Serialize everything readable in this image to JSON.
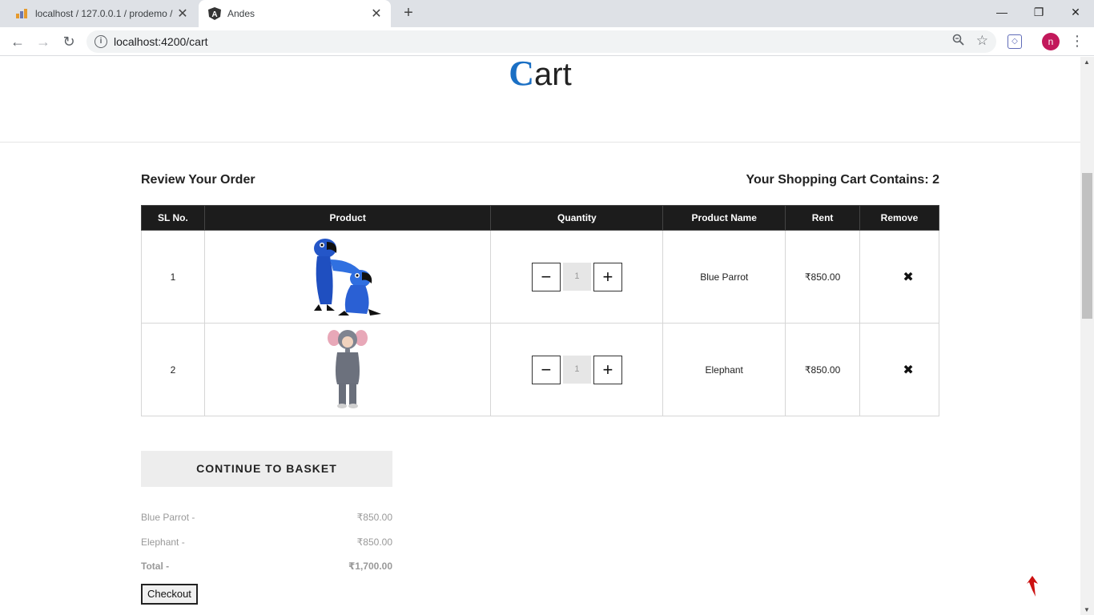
{
  "browser": {
    "tabs": [
      {
        "title": "localhost / 127.0.0.1 / prodemo /",
        "favicon": "phpmyadmin-icon",
        "active": false
      },
      {
        "title": "Andes",
        "favicon": "angular-icon",
        "active": true
      }
    ],
    "url": "localhost:4200/cart",
    "avatar_letter": "n"
  },
  "page": {
    "title_initial": "C",
    "title_rest": "art",
    "review_heading": "Review Your Order",
    "cart_count_label": "Your Shopping Cart Contains: 2"
  },
  "table": {
    "headers": [
      "SL No.",
      "Product",
      "Quantity",
      "Product Name",
      "Rent",
      "Remove"
    ],
    "rows": [
      {
        "sl": "1",
        "image": "blue-parrot-costume",
        "qty": "1",
        "name": "Blue Parrot",
        "rent": "₹850.00"
      },
      {
        "sl": "2",
        "image": "elephant-costume",
        "qty": "1",
        "name": "Elephant",
        "rent": "₹850.00"
      }
    ]
  },
  "continue_label": "CONTINUE TO BASKET",
  "summary": [
    {
      "label": "Blue Parrot -",
      "value": "₹850.00"
    },
    {
      "label": "Elephant -",
      "value": "₹850.00"
    },
    {
      "label": "Total -",
      "value": "₹1,700.00"
    }
  ],
  "checkout_label": "Checkout",
  "colors": {
    "accent": "#1a6fc4",
    "table_header": "#1c1c1c",
    "back_to_top": "#cc1111"
  }
}
